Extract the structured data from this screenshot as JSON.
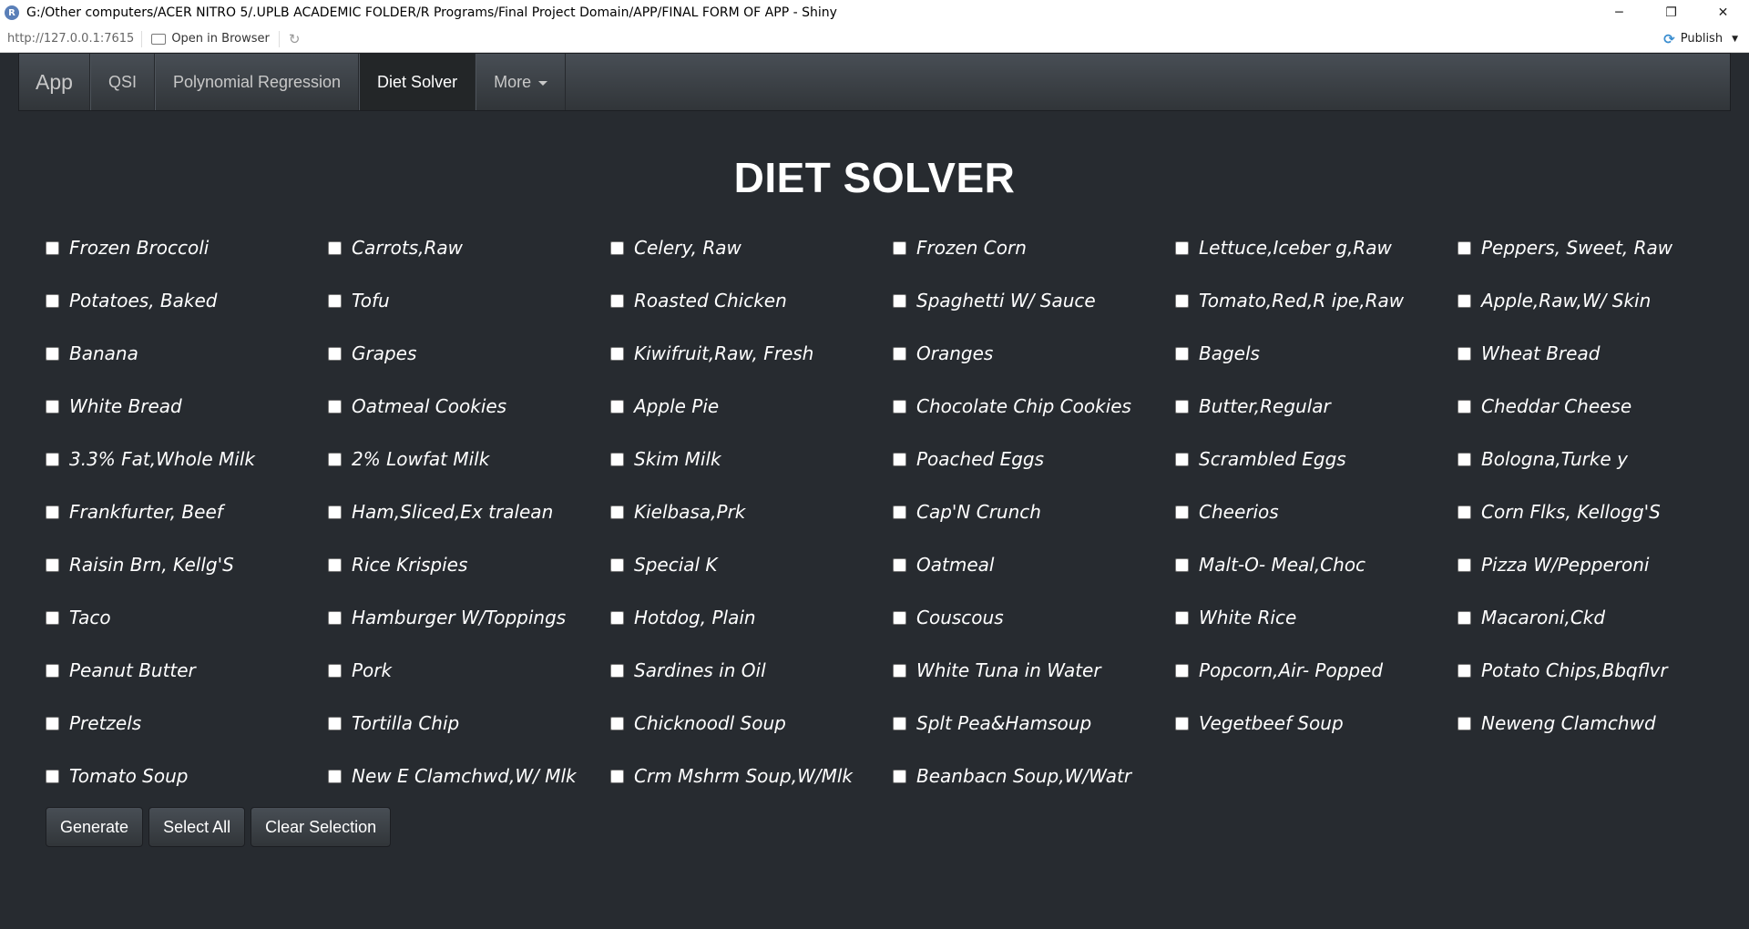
{
  "window": {
    "title": "G:/Other computers/ACER NITRO 5/.UPLB ACADEMIC FOLDER/R Programs/Final Project Domain/APP/FINAL FORM OF APP - Shiny",
    "app_icon_letter": "R",
    "minimize": "─",
    "restore": "❐",
    "close": "✕"
  },
  "toolbar": {
    "url": "http://127.0.0.1:7615",
    "open_in_browser": "Open in Browser",
    "refresh": "↻",
    "publish": "Publish"
  },
  "navbar": {
    "brand": "App",
    "tabs": [
      {
        "label": "QSI",
        "active": false
      },
      {
        "label": "Polynomial Regression",
        "active": false
      },
      {
        "label": "Diet Solver",
        "active": true
      },
      {
        "label": "More",
        "active": false,
        "dropdown": true
      }
    ]
  },
  "main": {
    "title": "DIET SOLVER",
    "foods": [
      "Frozen Broccoli",
      "Carrots,Raw",
      "Celery, Raw",
      "Frozen Corn",
      "Lettuce,Iceber g,Raw",
      "Peppers, Sweet, Raw",
      "Potatoes, Baked",
      "Tofu",
      "Roasted Chicken",
      "Spaghetti W/ Sauce",
      "Tomato,Red,R ipe,Raw",
      "Apple,Raw,W/ Skin",
      "Banana",
      "Grapes",
      "Kiwifruit,Raw, Fresh",
      "Oranges",
      "Bagels",
      "Wheat Bread",
      "White Bread",
      "Oatmeal Cookies",
      "Apple Pie",
      "Chocolate Chip Cookies",
      "Butter,Regular",
      "Cheddar Cheese",
      "3.3% Fat,Whole Milk",
      "2% Lowfat Milk",
      "Skim Milk",
      "Poached Eggs",
      "Scrambled Eggs",
      "Bologna,Turke y",
      "Frankfurter, Beef",
      "Ham,Sliced,Ex tralean",
      "Kielbasa,Prk",
      "Cap'N Crunch",
      "Cheerios",
      "Corn Flks, Kellogg'S",
      "Raisin Brn, Kellg'S",
      "Rice Krispies",
      "Special K",
      "Oatmeal",
      "Malt-O- Meal,Choc",
      "Pizza W/Pepperoni",
      "Taco",
      "Hamburger W/Toppings",
      "Hotdog, Plain",
      "Couscous",
      "White Rice",
      "Macaroni,Ckd",
      "Peanut Butter",
      "Pork",
      "Sardines in Oil",
      "White Tuna in Water",
      "Popcorn,Air- Popped",
      "Potato Chips,Bbqflvr",
      "Pretzels",
      "Tortilla Chip",
      "Chicknoodl Soup",
      "Splt Pea&Hamsoup",
      "Vegetbeef Soup",
      "Neweng Clamchwd",
      "Tomato Soup",
      "New E Clamchwd,W/ Mlk",
      "Crm Mshrm Soup,W/Mlk",
      "Beanbacn Soup,W/Watr"
    ],
    "buttons": {
      "generate": "Generate",
      "select_all": "Select All",
      "clear_selection": "Clear Selection"
    }
  }
}
